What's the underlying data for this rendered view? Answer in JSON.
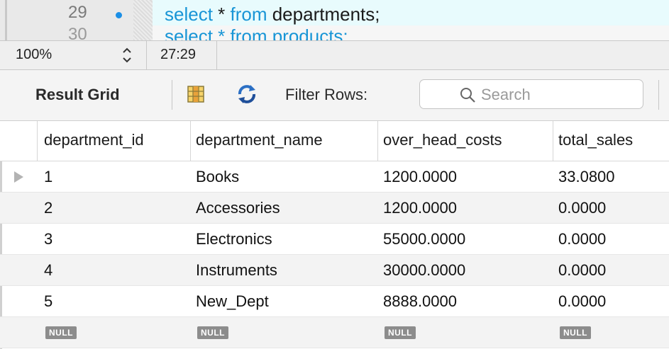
{
  "editor": {
    "line_29": "29",
    "line_30": "30",
    "code_29": {
      "kw1": "select",
      "star": " * ",
      "kw2": "from",
      "rest": " departments;"
    },
    "code_30": "select * from products;"
  },
  "status_bar": {
    "zoom": "100%",
    "cursor_position": "27:29"
  },
  "toolbar": {
    "result_grid_label": "Result Grid",
    "filter_label": "Filter Rows:",
    "search_placeholder": "Search",
    "search_value": ""
  },
  "grid": {
    "columns": [
      "department_id",
      "department_name",
      "over_head_costs",
      "total_sales"
    ],
    "rows": [
      [
        "1",
        "Books",
        "1200.0000",
        "33.0800"
      ],
      [
        "2",
        "Accessories",
        "1200.0000",
        "0.0000"
      ],
      [
        "3",
        "Electronics",
        "55000.0000",
        "0.0000"
      ],
      [
        "4",
        "Instruments",
        "30000.0000",
        "0.0000"
      ],
      [
        "5",
        "New_Dept",
        "8888.0000",
        "0.0000"
      ]
    ],
    "null_label": "NULL"
  },
  "colors": {
    "keyword": "#1895d6",
    "current_line_bg": "#e8fbfd",
    "null_badge": "#8c8c8c"
  }
}
